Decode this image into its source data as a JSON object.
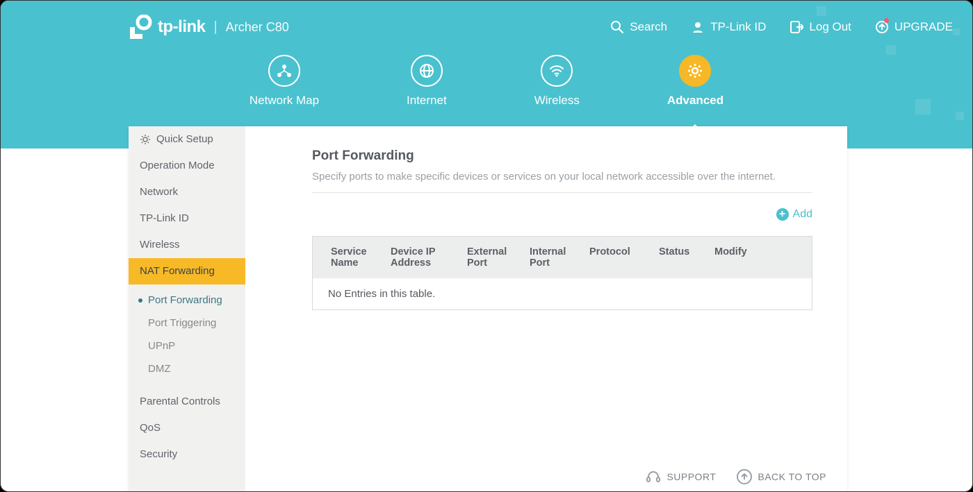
{
  "header": {
    "brand": "tp-link",
    "model": "Archer C80",
    "actions": {
      "search": "Search",
      "tplinkid": "TP-Link ID",
      "logout": "Log Out",
      "upgrade": "UPGRADE"
    }
  },
  "tabs": {
    "network_map": "Network Map",
    "internet": "Internet",
    "wireless": "Wireless",
    "advanced": "Advanced"
  },
  "sidebar": {
    "quick_setup": "Quick Setup",
    "operation_mode": "Operation Mode",
    "network": "Network",
    "tplink_id": "TP-Link ID",
    "wireless": "Wireless",
    "nat_forwarding": "NAT Forwarding",
    "sub": {
      "port_forwarding": "Port Forwarding",
      "port_triggering": "Port Triggering",
      "upnp": "UPnP",
      "dmz": "DMZ"
    },
    "parental": "Parental Controls",
    "qos": "QoS",
    "security": "Security"
  },
  "content": {
    "title": "Port Forwarding",
    "description": "Specify ports to make specific devices or services on your local network accessible over the internet.",
    "add": "Add",
    "table_headers": {
      "service_name": "Service Name",
      "device_ip": "Device IP Address",
      "external_port": "External Port",
      "internal_port": "Internal Port",
      "protocol": "Protocol",
      "status": "Status",
      "modify": "Modify"
    },
    "empty": "No Entries in this table."
  },
  "footer": {
    "support": "SUPPORT",
    "back_to_top": "BACK TO TOP"
  }
}
